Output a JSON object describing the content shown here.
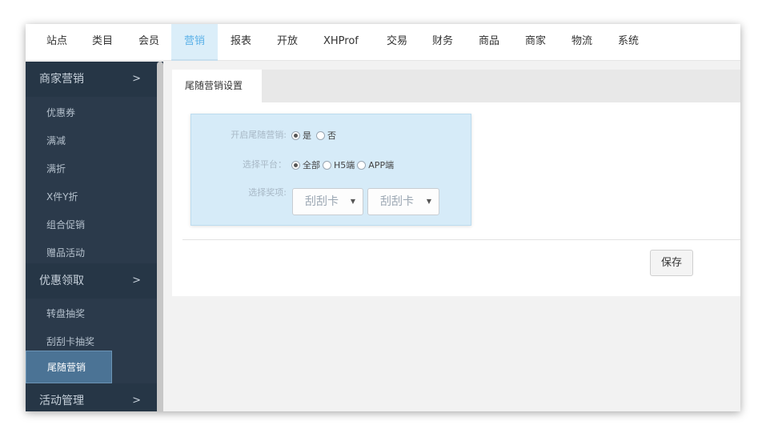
{
  "topnav": {
    "items": [
      {
        "label": "站点"
      },
      {
        "label": "类目"
      },
      {
        "label": "会员"
      },
      {
        "label": "营销",
        "active": true
      },
      {
        "label": "报表"
      },
      {
        "label": "开放"
      },
      {
        "label": "XHProf"
      },
      {
        "label": "交易"
      },
      {
        "label": "财务"
      },
      {
        "label": "商品"
      },
      {
        "label": "商家"
      },
      {
        "label": "物流"
      },
      {
        "label": "系统"
      }
    ]
  },
  "sidebar": {
    "groups": [
      {
        "label": "商家营销",
        "chevron": ">"
      },
      {
        "label": "优惠领取",
        "chevron": ">"
      },
      {
        "label": "活动管理",
        "chevron": ">"
      }
    ],
    "items": [
      {
        "label": "优惠券"
      },
      {
        "label": "满减"
      },
      {
        "label": "满折"
      },
      {
        "label": "X件Y折"
      },
      {
        "label": "组合促销"
      },
      {
        "label": "赠品活动"
      },
      {
        "label": "转盘抽奖"
      },
      {
        "label": "刮刮卡抽奖"
      },
      {
        "label": "尾随营销",
        "active": true
      }
    ]
  },
  "content": {
    "tab_label": "尾随营销设置",
    "form": {
      "enable_label": "开启尾随营销:",
      "enable_options": [
        {
          "label": "是",
          "checked": true
        },
        {
          "label": "否",
          "checked": false
        }
      ],
      "platform_label": "选择平台：",
      "platform_options": [
        {
          "label": "全部",
          "checked": true
        },
        {
          "label": "H5端",
          "checked": false
        },
        {
          "label": "APP端",
          "checked": false
        }
      ],
      "prize_label": "选择奖项:",
      "prize_select_1": "刮刮卡",
      "prize_select_2": "刮刮卡",
      "select_caret": "▼"
    },
    "save_label": "保存"
  },
  "colors": {
    "topnav_active_text": "#5bb1e8",
    "sidebar_bg": "#2b3a4b",
    "sidebar_active": "#4b7395",
    "form_box_bg": "#d6ebf8"
  }
}
